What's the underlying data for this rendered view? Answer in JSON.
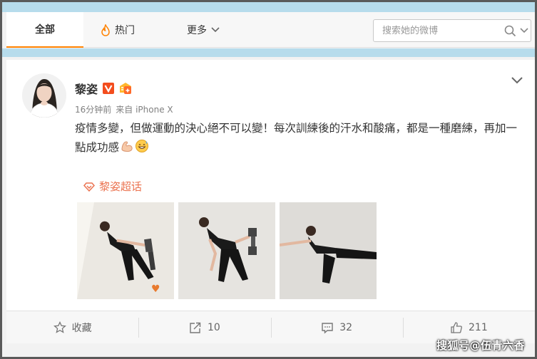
{
  "nav": {
    "tabs": [
      {
        "label": "全部",
        "active": true
      },
      {
        "label": "热门",
        "icon": "fire-icon"
      },
      {
        "label": "更多",
        "icon": "chevron-down-icon"
      }
    ],
    "search_placeholder": "搜索她的微博"
  },
  "post": {
    "author": "黎姿",
    "time": "16分钟前",
    "source": "来自 iPhone X",
    "text": "疫情多變，但做運動的決心絕不可以變！每次訓練後的汗水和酸痛，都是一種磨練，再加一點成功感",
    "emojis": [
      "flexed-biceps-icon",
      "grinning-sweat-icon"
    ],
    "topic": "黎姿超话",
    "images": [
      "workout-photo-1",
      "workout-photo-2",
      "workout-photo-3"
    ]
  },
  "actions": {
    "favorite": "收藏",
    "repost": "10",
    "comment": "32",
    "like": "211"
  },
  "watermark": "搜狐号@伍青六香",
  "colors": {
    "accent_orange": "#ff8200",
    "topic": "#eb7350",
    "bar_blue": "#b7dcec"
  }
}
